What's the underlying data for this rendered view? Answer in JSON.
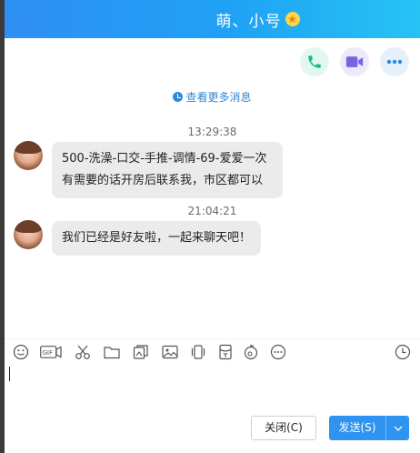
{
  "window": {
    "title": "萌、小号",
    "vip_badge_icon": "vip-star-icon",
    "title_color": "#2f93f0"
  },
  "chat_actions": [
    {
      "name": "phone-call",
      "icon": "phone-icon"
    },
    {
      "name": "video-call",
      "icon": "video-camera-icon"
    },
    {
      "name": "more-actions",
      "icon": "more-icon"
    }
  ],
  "history": {
    "more_messages_label": "查看更多消息"
  },
  "messages": [
    {
      "time": "13:29:38",
      "lines": [
        "500-洗澡-口交-手推-调情-69-爱爱一次",
        "有需要的话开房后联系我，市区都可以"
      ]
    },
    {
      "time": "21:04:21",
      "lines": [
        "我们已经是好友啦，一起来聊天吧！"
      ]
    }
  ],
  "toolbar": {
    "tools": [
      "emoji-icon",
      "gif-icon",
      "scissors-icon",
      "folder-icon",
      "sticker-icon",
      "image-icon",
      "shake-icon",
      "red-packet-icon",
      "music-icon",
      "more-icon"
    ],
    "history_icon": "history-clock-icon"
  },
  "composer": {
    "value": ""
  },
  "buttons": {
    "close_label": "关闭(C)",
    "send_label": "发送(S)"
  }
}
